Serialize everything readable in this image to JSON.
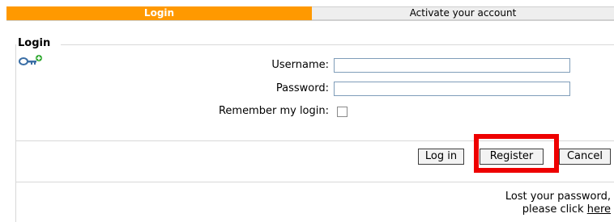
{
  "tabs": [
    {
      "label": "Login"
    },
    {
      "label": "Activate your account"
    }
  ],
  "colors": {
    "active_tab": "#ff9900",
    "highlight": "#ee0000"
  },
  "form": {
    "legend": "Login",
    "icon": "key-icon",
    "username_label": "Username:",
    "username_value": "",
    "password_label": "Password:",
    "password_value": "",
    "remember_label": "Remember my login:",
    "remember_checked": false
  },
  "buttons": {
    "login": "Log in",
    "register": "Register",
    "cancel": "Cancel"
  },
  "lost_password": {
    "line1": "Lost your password,",
    "line2_prefix": "please click",
    "link": "here"
  }
}
